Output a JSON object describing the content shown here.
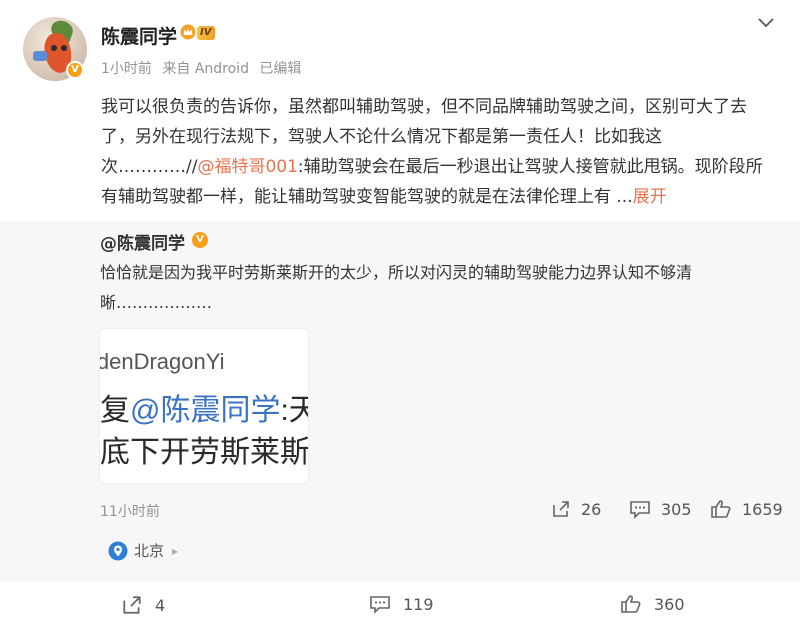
{
  "post": {
    "user_name": "陈震同学",
    "level_badge": "IV",
    "time": "1小时前",
    "source": "来自 Android",
    "edited": "已编辑",
    "text_part1": "我可以很负责的告诉你，虽然都叫辅助驾驶，但不同品牌辅助驾驶之间，区别可大了去了，另外在现行法规下，驾驶人不论什么情况下都是第一责任人！比如我这次…………//",
    "mention": "@福特哥001",
    "text_part2": ":辅助驾驶会在最后一秒退出让驾驶人接管就此甩锅。现阶段所有辅助驾驶都一样，能让辅助驾驶变智能驾驶的就是在法律伦理上有 ...",
    "expand_label": "展开"
  },
  "repost": {
    "author": "@陈震同学",
    "text": "恰恰就是因为我平时劳斯莱斯开的太少，所以对闪灵的辅助驾驶能力边界认知不够清晰………………",
    "image": {
      "line1": "ldenDragonYi",
      "line2_prefix": "复",
      "line2_mention": "@陈震同学",
      "line2_suffix": ":天",
      "line3": "底下开劳斯莱斯"
    },
    "time": "11小时前",
    "shares": "26",
    "comments": "305",
    "likes": "1659",
    "location": "北京"
  },
  "footer": {
    "shares": "4",
    "comments": "119",
    "likes": "360"
  },
  "colors": {
    "accent": "#eb7350",
    "badge": "#f79f17",
    "location_icon": "#2f7fd6",
    "repost_bg": "#f7f7f7"
  },
  "icons": [
    "avatar",
    "crown-icon",
    "chevron-down-icon",
    "verified-badge-icon",
    "share-icon",
    "comment-icon",
    "like-icon",
    "location-icon"
  ]
}
